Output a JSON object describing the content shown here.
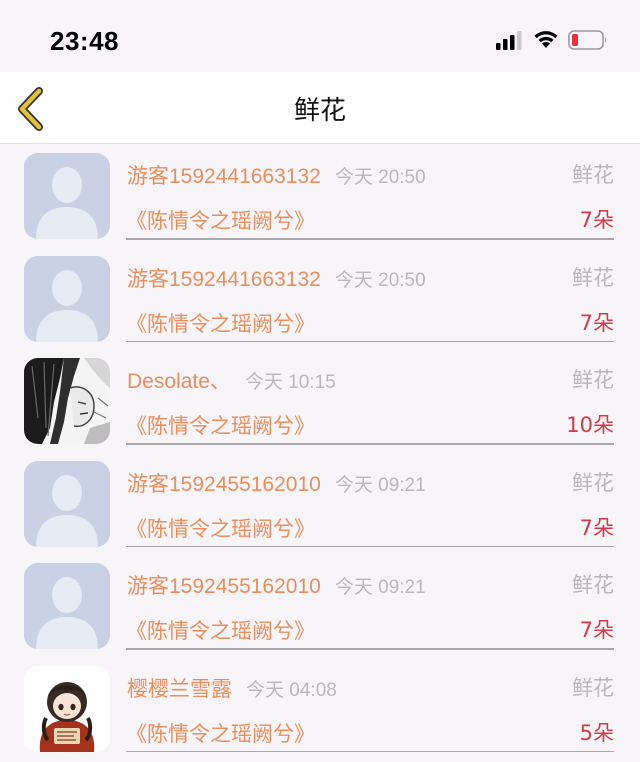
{
  "status_bar": {
    "time": "23:48",
    "battery_color": "#e8353b"
  },
  "nav": {
    "title": "鲜花",
    "back_icon": "chevron-left-icon",
    "accent": "#e8c13a"
  },
  "items": [
    {
      "user": "游客1592441663132",
      "time": "今天 20:50",
      "type": "鲜花",
      "book": "《陈情令之瑶阙兮》",
      "count": "7朵",
      "avatar": "default-avatar-icon"
    },
    {
      "user": "游客1592441663132",
      "time": "今天 20:50",
      "type": "鲜花",
      "book": "《陈情令之瑶阙兮》",
      "count": "7朵",
      "avatar": "default-avatar-icon"
    },
    {
      "user": "Desolate、",
      "time": "今天 10:15",
      "type": "鲜花",
      "book": "《陈情令之瑶阙兮》",
      "count": "10朵",
      "avatar": "manga-avatar"
    },
    {
      "user": "游客1592455162010",
      "time": "今天 09:21",
      "type": "鲜花",
      "book": "《陈情令之瑶阙兮》",
      "count": "7朵",
      "avatar": "default-avatar-icon"
    },
    {
      "user": "游客1592455162010",
      "time": "今天 09:21",
      "type": "鲜花",
      "book": "《陈情令之瑶阙兮》",
      "count": "7朵",
      "avatar": "default-avatar-icon"
    },
    {
      "user": "樱樱兰雪露",
      "time": "今天 04:08",
      "type": "鲜花",
      "book": "《陈情令之瑶阙兮》",
      "count": "5朵",
      "avatar": "chibi-avatar"
    }
  ]
}
